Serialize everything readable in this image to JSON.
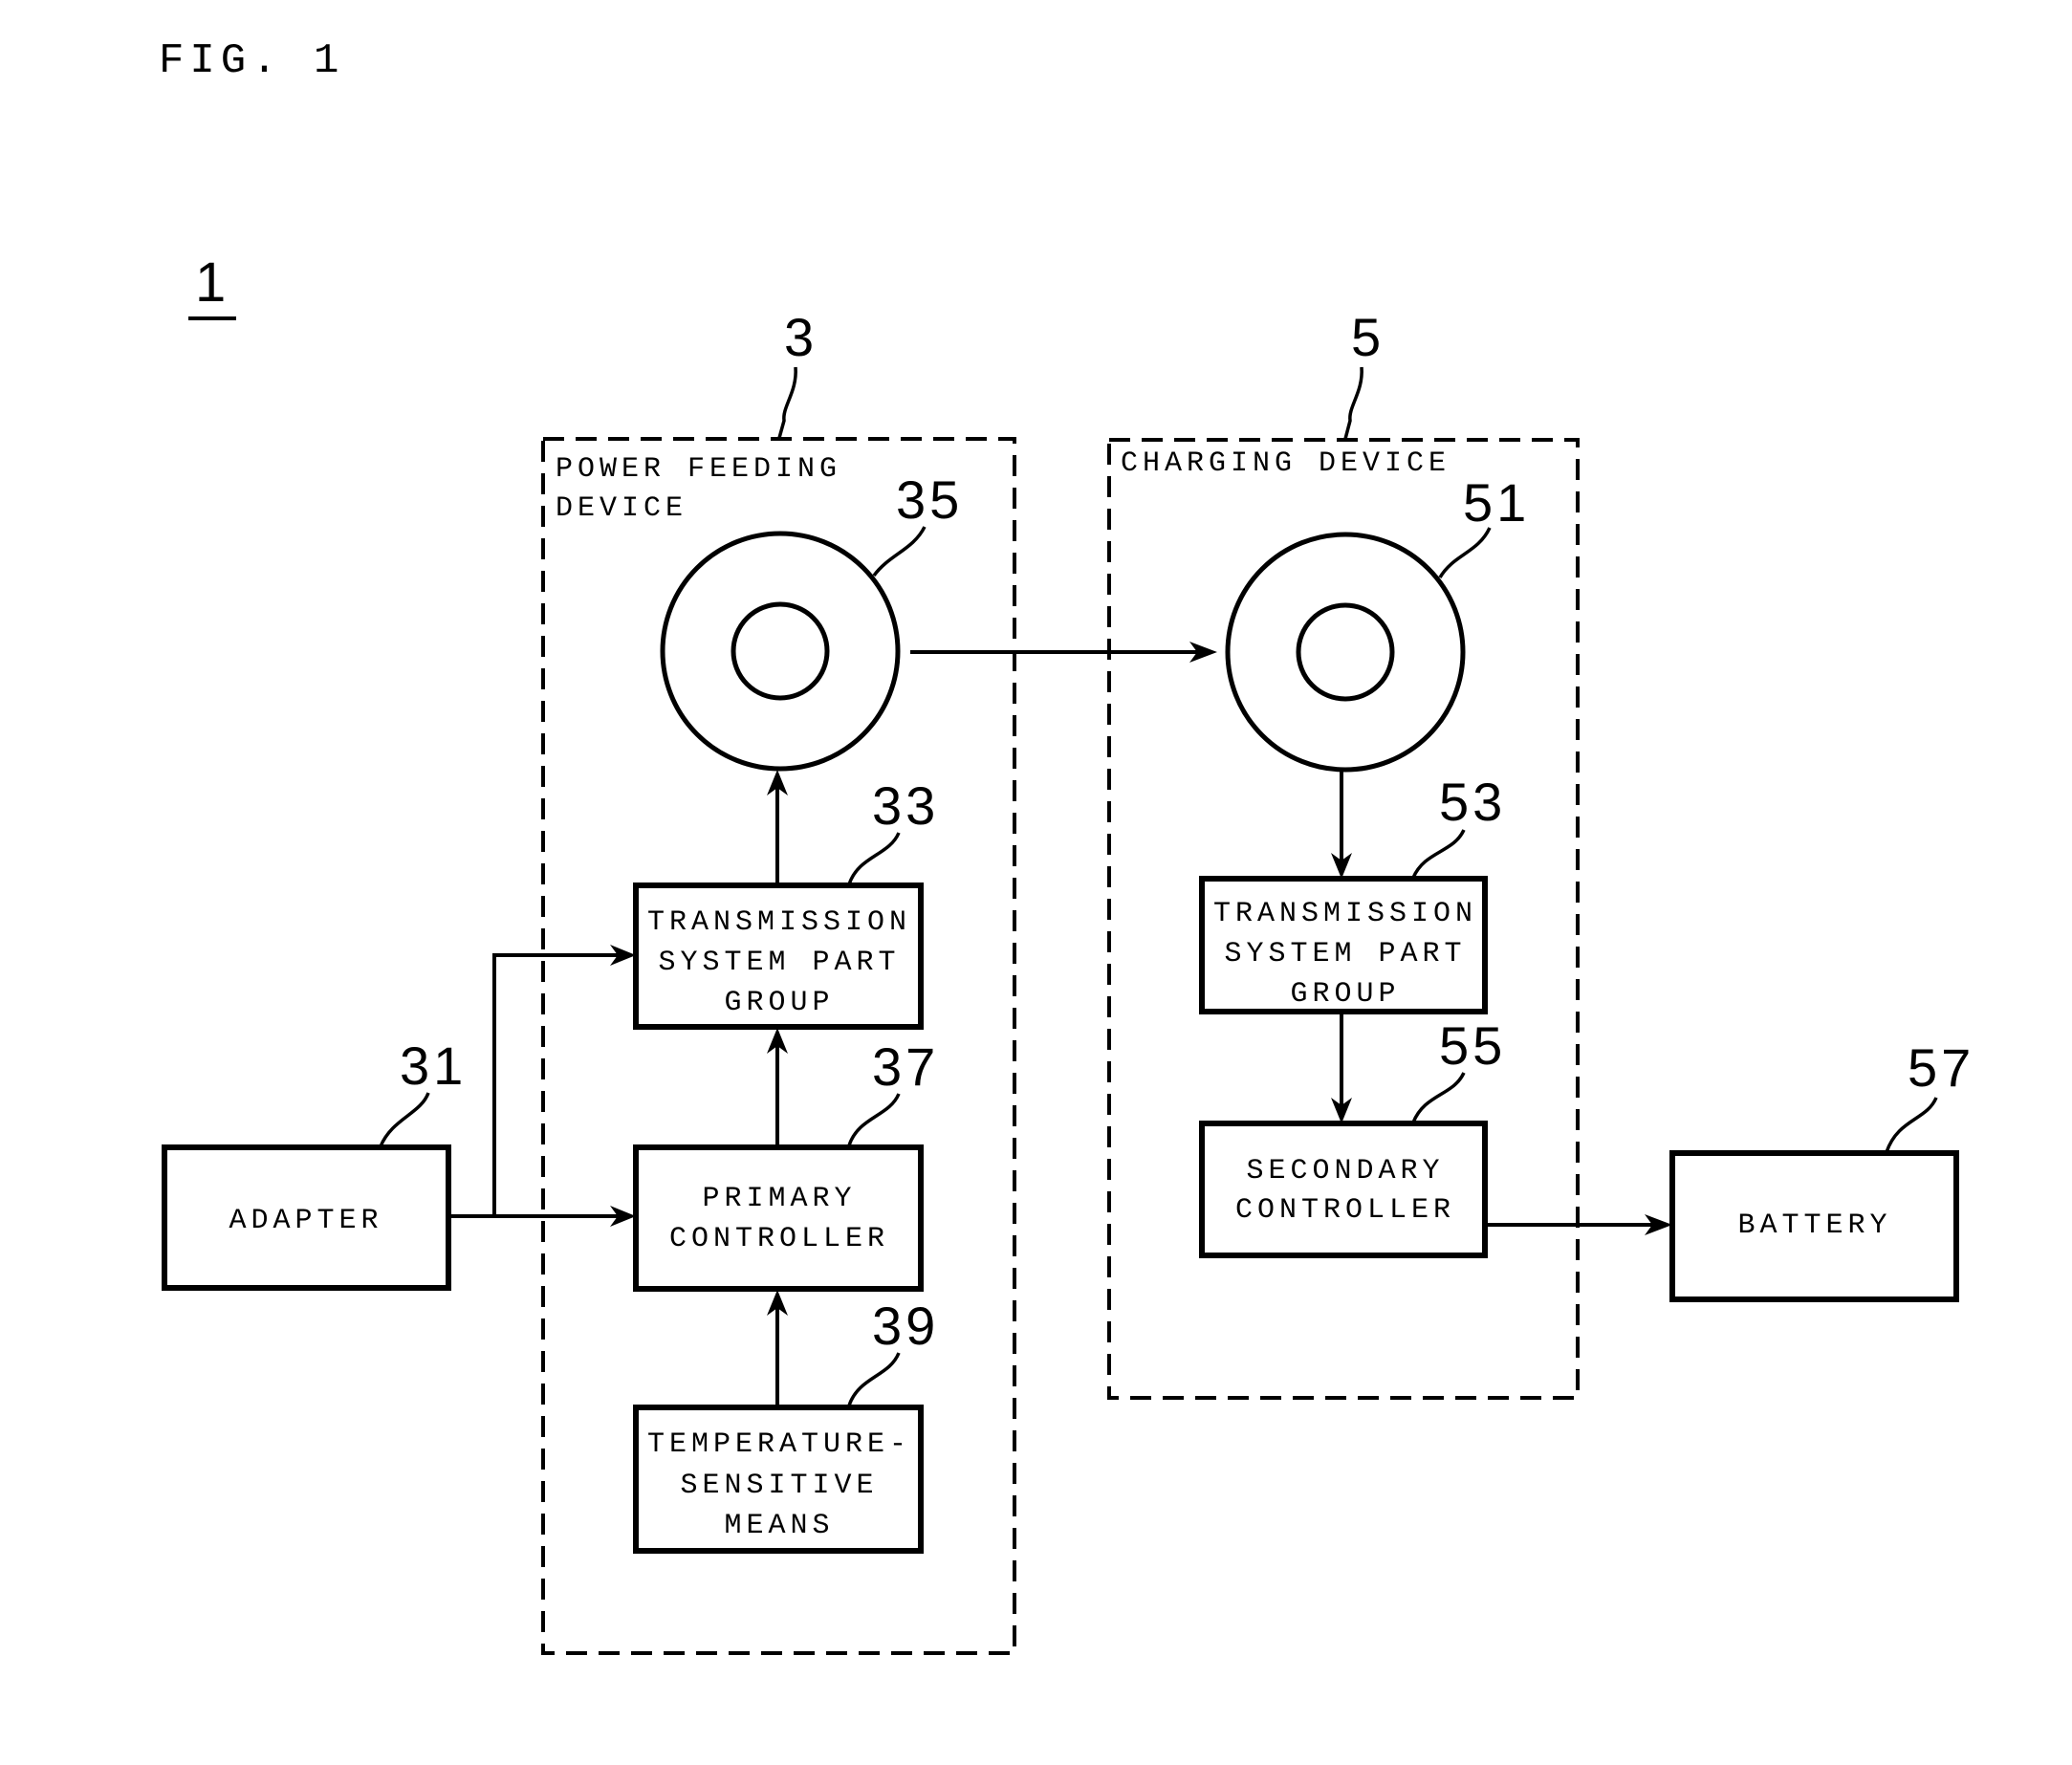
{
  "figure": {
    "title": "FIG. 1",
    "system_ref": "1"
  },
  "groups": [
    {
      "id": "power-feeding-device",
      "ref": "3",
      "label_lines": [
        "POWER FEEDING",
        "DEVICE"
      ]
    },
    {
      "id": "charging-device",
      "ref": "5",
      "label_lines": [
        "CHARGING DEVICE"
      ]
    }
  ],
  "blocks": {
    "adapter": {
      "ref": "31",
      "lines": [
        "ADAPTER"
      ]
    },
    "tspg_primary": {
      "ref": "33",
      "lines": [
        "TRANSMISSION",
        "SYSTEM PART",
        "GROUP"
      ]
    },
    "coil_primary": {
      "ref": "35"
    },
    "primary_controller": {
      "ref": "37",
      "lines": [
        "PRIMARY",
        "CONTROLLER"
      ]
    },
    "temperature_sensitive": {
      "ref": "39",
      "lines": [
        "TEMPERATURE-",
        "SENSITIVE",
        "MEANS"
      ]
    },
    "coil_secondary": {
      "ref": "51"
    },
    "tspg_secondary": {
      "ref": "53",
      "lines": [
        "TRANSMISSION",
        "SYSTEM PART",
        "GROUP"
      ]
    },
    "secondary_controller": {
      "ref": "55",
      "lines": [
        "SECONDARY",
        "CONTROLLER"
      ]
    },
    "battery": {
      "ref": "57",
      "lines": [
        "BATTERY"
      ]
    }
  },
  "connections": [
    {
      "from": "adapter",
      "to": "primary_controller"
    },
    {
      "from": "adapter",
      "to": "tspg_primary"
    },
    {
      "from": "primary_controller",
      "to": "tspg_primary"
    },
    {
      "from": "temperature_sensitive",
      "to": "primary_controller"
    },
    {
      "from": "tspg_primary",
      "to": "coil_primary"
    },
    {
      "from": "coil_primary",
      "to": "coil_secondary"
    },
    {
      "from": "coil_secondary",
      "to": "tspg_secondary"
    },
    {
      "from": "tspg_secondary",
      "to": "secondary_controller"
    },
    {
      "from": "secondary_controller",
      "to": "battery"
    }
  ]
}
